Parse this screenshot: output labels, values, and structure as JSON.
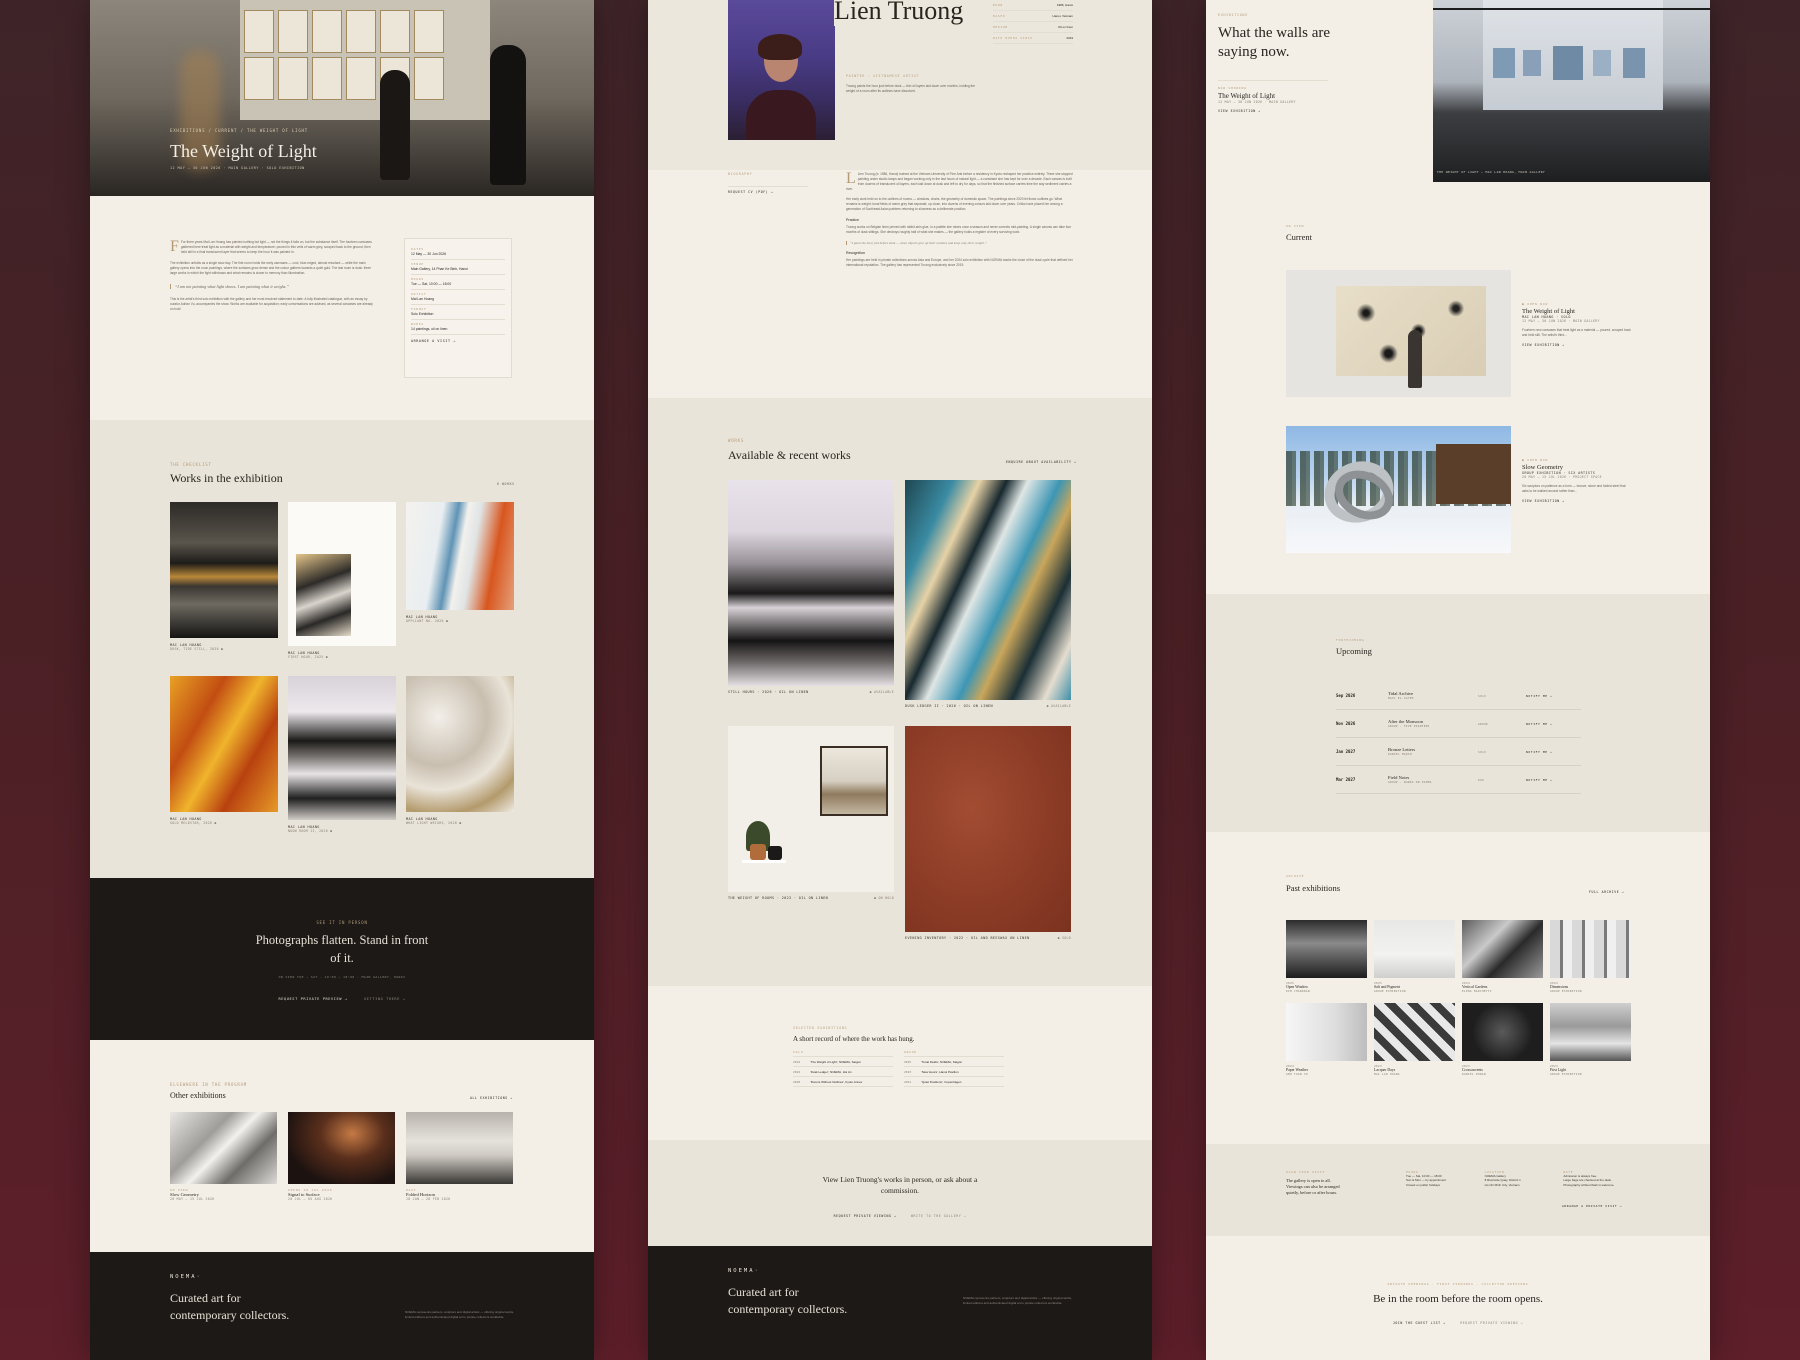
{
  "col1": {
    "hero": {
      "breadcrumb": "EXHIBITIONS / CURRENT / THE WEIGHT OF LIGHT",
      "title": "The Weight of Light",
      "meta": "12 MAY — 30 JUN 2026 · MAIN GALLERY · SOLO EXHIBITION"
    },
    "intro": {
      "p1": "For three years Mai Lan Hoang has painted nothing but light — not the things it falls on, but the substance itself. The fourteen canvases gathered here treat light as a material with weight and temperature: poured in thin veils of warm grey, scraped back to the ground, then held still in a final translucent layer that seems to keep the hour it was painted in.",
      "p2": "The exhibition unfolds as a single slow day. The first room holds the early canvases — cool, blue-edged, almost reluctant — while the main gallery opens into the noon paintings, where the surfaces grow dense and the colour gathers towards a quiet gold. The last room is dusk: three large works in which the light withdraws and what remains is closer to memory than illumination.",
      "quote": "“I am not painting what light shows. I am painting what it weighs.”",
      "p3": "This is the artist's third solo exhibition with the gallery and her most resolved statement to date. A fully illustrated catalogue, with an essay by curator Adrian Vu, accompanies the show. Works are available for acquisition; early conversations are advised, as several canvases are already on hold."
    },
    "facts": [
      {
        "label": "DATES",
        "value": "12 May — 30 Jun 2026"
      },
      {
        "label": "VENUE",
        "value": "Main Gallery, 14 Phan Ke Binh, Hanoi"
      },
      {
        "label": "HOURS",
        "value": "Tue — Sat, 10:00 — 18:00"
      },
      {
        "label": "ARTIST",
        "value": "Mai Lan Hoang"
      },
      {
        "label": "FORMAT",
        "value": "Solo Exhibition"
      },
      {
        "label": "WORKS",
        "value": "14 paintings, oil on linen"
      }
    ],
    "facts_link": "ARRANGE A VISIT →",
    "checklist": {
      "eyebrow": "THE CHECKLIST",
      "title": "Works in the exhibition",
      "count": "6 WORKS",
      "items": [
        {
          "artist": "MAI LAN HOANG",
          "detail": "DUSK, TIDE STILL, 2026 ●"
        },
        {
          "artist": "MAI LAN HOANG",
          "detail": "FIRST HOUR, 2025 ●"
        },
        {
          "artist": "MAI LAN HOANG",
          "detail": "APPLIANT NO. 2026 ●"
        },
        {
          "artist": "MAI LAN HOANG",
          "detail": "GOLD MELDSTAR, 2026 ●"
        },
        {
          "artist": "MAI LAN HOANG",
          "detail": "NOON ROOM II, 2026 ●"
        },
        {
          "artist": "MAI LAN HOANG",
          "detail": "WHAT LIGHT WEIGHS, 2026 ●"
        }
      ]
    },
    "cta": {
      "eyebrow": "SEE IT IN PERSON",
      "title": "Photographs flatten. Stand in front of it.",
      "meta": "ON VIEW TUE — SAT · 10:00 — 18:00 · MAIN GALLERY, HANOI",
      "btn1": "REQUEST PRIVATE PREVIEW →",
      "btn2": "GETTING THERE →"
    },
    "other": {
      "eyebrow": "ELSEWHERE IN THE PROGRAM",
      "title": "Other exhibitions",
      "all": "ALL EXHIBITIONS →",
      "items": [
        {
          "tag": "ON VIEW",
          "title": "Slow Geometry",
          "dates": "20 MAY — 15 JUL 2026"
        },
        {
          "tag": "OPENS 20 JUL 2026",
          "title": "Signal to Surface",
          "dates": "20 JUL — 05 AUG 2026"
        },
        {
          "tag": "PAST",
          "title": "Folded Horizon",
          "dates": "18 JAN — 28 FEB 2026"
        }
      ]
    },
    "footer": {
      "brand": "NOEMA·",
      "tagline": "Curated art for contemporary collectors.",
      "blurb": "NOEMA represents painters, sculptors and digital artists — offering original works, limited editions and authenticated digital art to private collectors worldwide."
    }
  },
  "col2": {
    "artist": {
      "name": "Lien Truong",
      "role": "PAINTER · VIETNAMESE ARTIST",
      "lede": "Truong paints the hour just before dusk — thin oil layers laid down over months, holding the weight of a room after its outlines have dissolved.",
      "facts": [
        {
          "label": "BORN",
          "value": "1986, Hanoi"
        },
        {
          "label": "BASED",
          "value": "Hanoi, Vietnam"
        },
        {
          "label": "MEDIUM",
          "value": "Oil on linen"
        },
        {
          "label": "WITH NOEMA SINCE",
          "value": "2019"
        }
      ]
    },
    "bio": {
      "side_label": "BIOGRAPHY",
      "side_link": "REQUEST CV (PDF) →",
      "p1": "Lien Truong (b. 1986, Hanoi) trained at the Vietnam University of Fine Arts before a residency in Kyoto reshaped her practice entirely. There she stopped painting under studio lamps and began working only in the last hours of natural light — a constraint she has kept for over a decade. Each canvas is built from dozens of translucent oil layers, each laid down at dusk and left to dry for days, so that the finished surface carries time the way sediment carries a river.",
      "p2": "Her early work held on to the outlines of rooms — windows, chairs, the geometry of domestic space. The paintings since 2020 let those outlines go. What remains is weight: tonal fields of warm grey that separate, up close, into dozens of evening colours laid down over years. Critics have placed her among a generation of Southeast Asian painters returning to slowness as a deliberate position.",
      "h1": "Practice",
      "p3": "Truong works on Belgian linen primed with rabbit-skin glue, in a palette she mixes once a season and never corrects mid-painting. A single canvas can take four months of dusk sittings. She destroys roughly half of what she makes — the gallery holds a register of every surviving work.",
      "quote": "“I paint the hour just before dusk — when objects give up their outlines and keep only their weight.”",
      "h2": "Recognition",
      "p4": "Her paintings are held in private collections across Asia and Europe, and her 2024 solo exhibition with NOEMA marks the close of the dusk cycle that defined her international reputation. The gallery has represented Truong exclusively since 2019."
    },
    "works": {
      "eyebrow": "WORKS",
      "title": "Available & recent works",
      "enquire": "ENQUIRE ABOUT AVAILABILITY →",
      "items": [
        {
          "caption": "STILL HOURS · 2026 · OIL ON LINEN",
          "status": "● AVAILABLE"
        },
        {
          "caption": "DUSK LEDGER II · 2026 · OIL ON LINEN",
          "status": "● AVAILABLE"
        },
        {
          "caption": "THE WEIGHT OF ROOMS · 2023 · OIL ON LINEN",
          "status": "● ON HOLD"
        },
        {
          "caption": "EVENING INVENTORY · 2022 · OIL AND BEESWAX ON LINEN",
          "status": "● SOLD"
        }
      ]
    },
    "record": {
      "eyebrow": "SELECTED EXHIBITIONS",
      "title": "A short record of where the work has hung.",
      "solo_label": "SOLO",
      "group_label": "GROUP",
      "solo": [
        {
          "year": "2024",
          "text": "'The Weight of Light', NOEMA, Saigon"
        },
        {
          "year": "2022",
          "text": "'Dusk Ledger', NOEMA, Hoi An"
        },
        {
          "year": "2020",
          "text": "'Rooms Without Outlines', Kyoto Annex"
        }
      ],
      "group": [
        {
          "year": "2025",
          "text": "'Tonal Fields', NOEMA, Saigon"
        },
        {
          "year": "2023",
          "text": "'Slow Hours', Hanoi Pavilion"
        },
        {
          "year": "2021",
          "text": "'Quiet Positions', Copenhagen"
        }
      ]
    },
    "cta": {
      "title": "View Lien Truong's works in person, or ask about a commission.",
      "btn1": "REQUEST PRIVATE VIEWING →",
      "btn2": "WRITE TO THE GALLERY →"
    },
    "footer": {
      "brand": "NOEMA·",
      "tagline": "Curated art for contemporary collectors.",
      "blurb": "NOEMA represents painters, sculptors and digital artists — offering original works, limited editions and authenticated digital art to private collectors worldwide."
    }
  },
  "col3": {
    "hero": {
      "eyebrow": "EXHIBITIONS",
      "title": "What the walls are saying now.",
      "now_label": "NOW SHOWING",
      "now_title": "The Weight of Light",
      "now_meta": "12 MAY — 30 JUN 2026 · MAIN GALLERY",
      "now_link": "VIEW EXHIBITION →",
      "image_caption": "THE WEIGHT OF LIGHT — MAI LAN HOANG, MAIN GALLERY"
    },
    "current": {
      "eyebrow": "ON VIEW",
      "title": "Current",
      "items": [
        {
          "tag": "● OPEN NOW",
          "title": "The Weight of Light",
          "sub": "MAI LAN HOANG · SOLO",
          "meta": "12 MAY — 30 JUN 2026 · MAIN GALLERY",
          "desc": "Fourteen new canvases that treat light as a material — poured, scraped back and held still. The artist's third...",
          "link": "VIEW EXHIBITION →"
        },
        {
          "tag": "● OPEN NOW",
          "title": "Slow Geometry",
          "sub": "GROUP EXHIBITION · SIX ARTISTS",
          "meta": "20 MAY — 15 JUL 2026 · PROJECT SPACE",
          "desc": "Six sculptors on patience as a form — bronze, stone and folded steel that asks to be walked around rather than...",
          "link": "VIEW EXHIBITION →"
        }
      ]
    },
    "upcoming": {
      "eyebrow": "FORTHCOMING",
      "title": "Upcoming",
      "rows": [
        {
          "date": "Sep 2026",
          "title": "Tidal Archive",
          "sub": "NGOC EL-SAYED",
          "kind": "SOLO",
          "link": "NOTIFY ME →"
        },
        {
          "date": "Nov 2026",
          "title": "After the Monsoon",
          "sub": "GROUP · FIVE PAINTERS",
          "kind": "GROUP",
          "link": "NOTIFY ME →"
        },
        {
          "date": "Jan 2027",
          "title": "Bronze Letters",
          "sub": "DANIEL MARSH",
          "kind": "SOLO",
          "link": "NOTIFY ME →"
        },
        {
          "date": "Mar 2027",
          "title": "Field Notes",
          "sub": "GROUP · WORKS ON PAPER",
          "kind": "DUO",
          "link": "NOTIFY ME →"
        }
      ]
    },
    "past": {
      "eyebrow": "ARCHIVE",
      "title": "Past exhibitions",
      "link": "FULL ARCHIVE →",
      "items": [
        {
          "year": "2025",
          "title": "Open Window",
          "sub": "KIM CHANDRAN"
        },
        {
          "year": "2025",
          "title": "Salt and Pigment",
          "sub": "GROUP EXHIBITION"
        },
        {
          "year": "2024",
          "title": "Vertical Gardens",
          "sub": "ELENA MARCHETTI"
        },
        {
          "year": "2024",
          "title": "Dimensions",
          "sub": "GROUP EXHIBITION"
        },
        {
          "year": "2024",
          "title": "Paper Weather",
          "sub": "ANH TUAN VO"
        },
        {
          "year": "2023",
          "title": "Lacquer Days",
          "sub": "MAI LAN HOANG"
        },
        {
          "year": "2023",
          "title": "Crosscurrents",
          "sub": "DANIEL ROWAN"
        },
        {
          "year": "2023",
          "title": "First Light",
          "sub": "GROUP EXHIBITION"
        }
      ]
    },
    "visit": {
      "eyebrow": "PLAN YOUR VISIT",
      "text": "The gallery is open to all. Viewings can also be arranged quietly, before or after hours.",
      "cols": [
        {
          "label": "HOURS",
          "lines": [
            "Tue — Sat, 10:00 — 18:00",
            "Sun & Mon — by appointment",
            "Closed on public holidays"
          ]
        },
        {
          "label": "LOCATION",
          "lines": [
            "NOEMA Gallery",
            "8 Riverside Quay, District 1",
            "Ho Chi Minh City, Vietnam"
          ]
        },
        {
          "label": "NOTE",
          "lines": [
            "Admission is always free.",
            "Large bags are checked at the desk.",
            "Photography without flash is welcome."
          ]
        }
      ],
      "link": "ARRANGE A PRIVATE VISIT →"
    },
    "cta": {
      "eyebrow": "PRIVATE OPENINGS · FIRST VIEWINGS · COLLECTOR PREVIEWS",
      "title": "Be in the room before the room opens.",
      "btn1": "JOIN THE GUEST LIST →",
      "btn2": "REQUEST PRIVATE VIEWING →"
    }
  }
}
